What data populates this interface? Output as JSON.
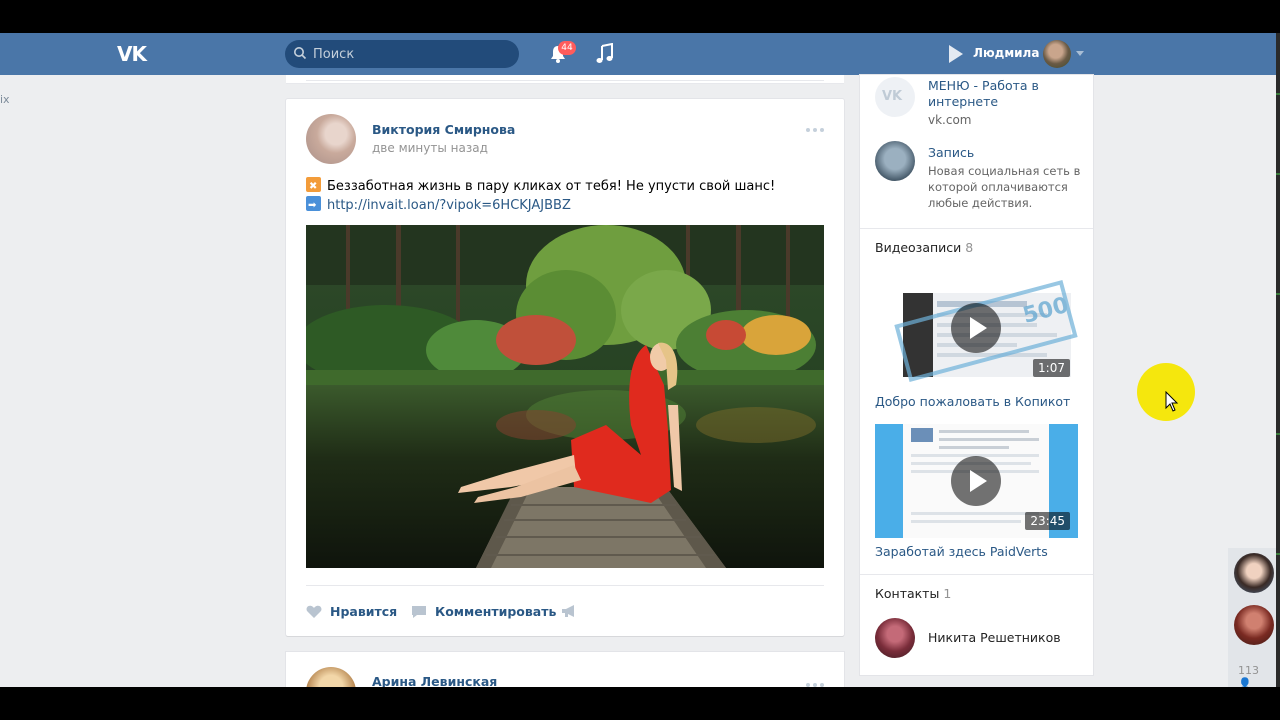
{
  "header": {
    "logo": "VK",
    "search_placeholder": "Поиск",
    "notifications_count": "44",
    "user_name": "Людмила"
  },
  "left_partial_text": "ix",
  "post": {
    "author": "Виктория Смирнова",
    "time": "две минуты назад",
    "text_line1": "Беззаботная жизнь в пару кликах от тебя! Не упусти свой шанс!",
    "link": "http://invait.loan/?vipok=6HCKJAJBBZ",
    "actions": {
      "like": "Нравится",
      "comment": "Комментировать"
    }
  },
  "post2": {
    "author": "Арина Левинская"
  },
  "right": {
    "links": [
      {
        "title": "МЕНЮ - Работа в интернете",
        "url": "vk.com"
      },
      {
        "title": "Запись",
        "sub": "Новая социальная сеть в которой оплачиваются любые действия."
      }
    ],
    "videos_label": "Видеозаписи",
    "videos_count": "8",
    "videos": [
      {
        "title": "Добро пожаловать в Копикот",
        "duration": "1:07"
      },
      {
        "title": "Заработай здесь PaidVerts",
        "duration": "23:45"
      }
    ],
    "contacts_label": "Контакты",
    "contacts_count": "1",
    "contacts": [
      {
        "name": "Никита Решетников"
      }
    ]
  },
  "dock": {
    "online_count": "113"
  },
  "colors": {
    "header": "#4a76a8",
    "link": "#2a5885",
    "background": "#edeef0"
  }
}
